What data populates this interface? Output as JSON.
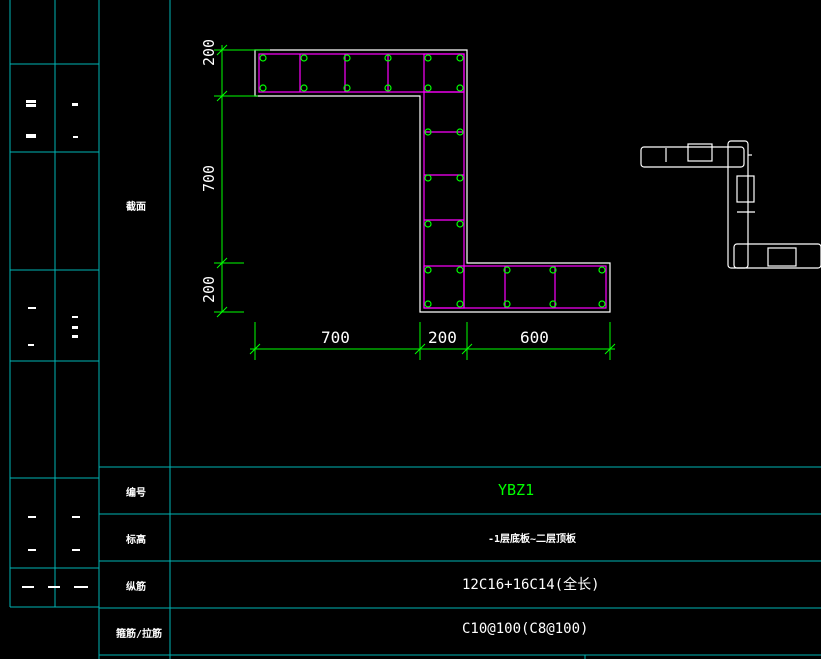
{
  "drawing": {
    "dimensions": {
      "top_left": "200",
      "left_middle": "700",
      "bottom_left": "200",
      "bottom_a": "700",
      "bottom_b": "200",
      "bottom_c": "600"
    }
  },
  "table": {
    "row_headers": [
      "截面",
      "编号",
      "标高",
      "纵筋",
      "箍筋/拉筋"
    ],
    "values": {
      "id": "YBZ1",
      "elevation": "-1层底板~二层顶板",
      "longitudinal": "12C16+16C14(全长)",
      "stirrup": "C10@100(C8@100)"
    }
  },
  "colors": {
    "grid": "#00b4b4",
    "outline": "#ffffff",
    "rebar": "#ff00ff",
    "bars": "#00ff00",
    "dimension": "#00ff00",
    "id_text": "#00ff00"
  }
}
